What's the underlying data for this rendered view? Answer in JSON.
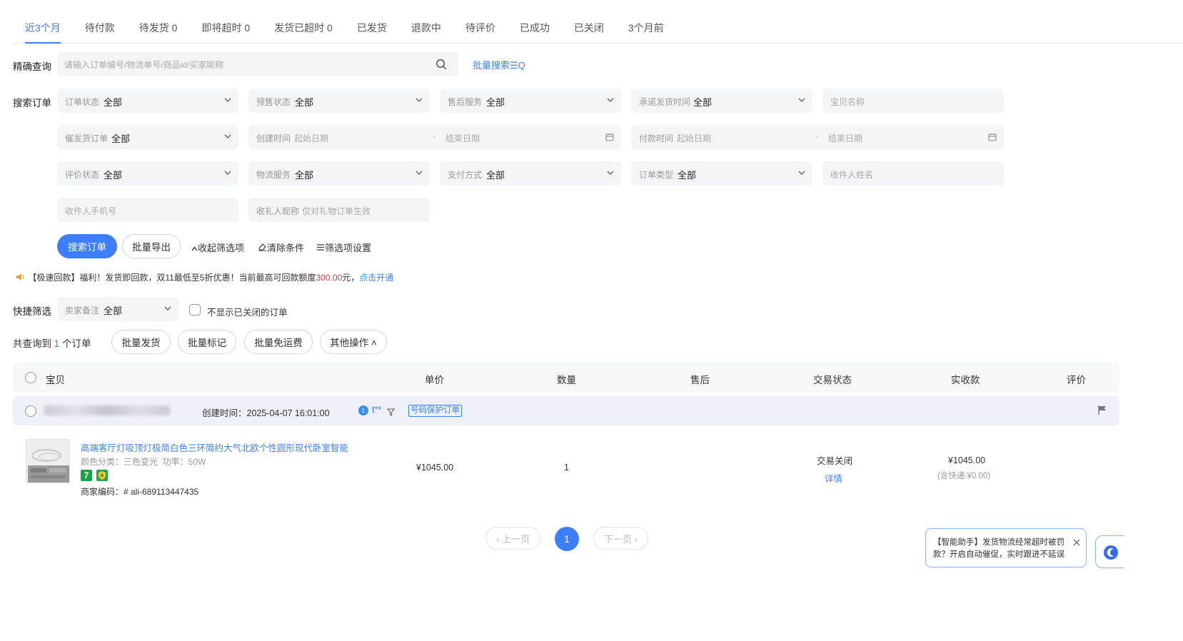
{
  "tabs": [
    "近3个月",
    "待付款",
    "待发货 0",
    "即将超时 0",
    "发货已超时 0",
    "已发货",
    "退款中",
    "待评价",
    "已成功",
    "已关闭",
    "3个月前"
  ],
  "precise": {
    "label": "精确查询",
    "placeholder": "请输入订单编号/物流单号/商品id/买家昵称",
    "batch_search": "批量搜索☰Q"
  },
  "filters": {
    "label": "搜索订单",
    "order_status": {
      "label": "订单状态",
      "value": "全部"
    },
    "presale_status": {
      "label": "预售状态",
      "value": "全部"
    },
    "after_sale": {
      "label": "售后服务",
      "value": "全部"
    },
    "promised_ship": {
      "label": "承诺发货时间",
      "value": "全部"
    },
    "item_name": {
      "placeholder": "宝贝名称"
    },
    "urge_ship": {
      "label": "催发货订单",
      "value": "全部"
    },
    "created_time": {
      "label": "创建时间",
      "start": "起始日期",
      "sep": "-",
      "end": "结束日期"
    },
    "paid_time": {
      "label": "付款时间",
      "start": "起始日期",
      "sep": "-",
      "end": "结束日期"
    },
    "review_status": {
      "label": "评价状态",
      "value": "全部"
    },
    "logistics": {
      "label": "物流服务",
      "value": "全部"
    },
    "payment": {
      "label": "支付方式",
      "value": "全部"
    },
    "order_type": {
      "label": "订单类型",
      "value": "全部"
    },
    "receiver_name": {
      "placeholder": "收件人姓名"
    },
    "receiver_phone": {
      "placeholder": "收件人手机号"
    },
    "gift_nick": {
      "label": "收礼人昵称",
      "hint": "仅对礼物订单生效"
    }
  },
  "actions": {
    "search": "搜索订单",
    "export": "批量导出",
    "collapse": "收起筛选项",
    "clear": "清除条件",
    "settings": "筛选项设置"
  },
  "notice": {
    "text1": "【极速回款】福利！发货即回款，双11最低至5折优惠！当前最高可回款额度",
    "amount": "300.00",
    "text2": "元，",
    "link": "点击开通"
  },
  "quick": {
    "label": "快捷筛选",
    "seller_note": {
      "label": "卖家备注",
      "value": "全部"
    },
    "hide_closed": "不显示已关闭的订单"
  },
  "summary": {
    "prefix": "共查询到",
    "count": "1",
    "suffix": "个订单"
  },
  "bulk": {
    "ship": "批量发货",
    "mark": "批量标记",
    "free_ship": "批量免运费",
    "other": "其他操作 ˄"
  },
  "table": {
    "headers": [
      "宝贝",
      "单价",
      "数量",
      "售后",
      "交易状态",
      "实收款",
      "评价"
    ]
  },
  "order": {
    "created": "创建时间：2025-04-07 16:01:00",
    "buyer": "t**",
    "badge": "号码保护订单",
    "product": {
      "title": "高端客厅灯吸顶灯极简白色三环简约大气北欧个性圆形现代卧室智能",
      "spec": "颜色分类：三色变光  功率：50W",
      "tag7": "7",
      "merchant_code": "商家编码：# ali-689113447435"
    },
    "price": "¥1045.00",
    "qty": "1",
    "status": "交易关闭",
    "detail": "详情",
    "received": "¥1045.00",
    "shipping": "(含快递:¥0.00)"
  },
  "pager": {
    "prev": "‹ 上一页",
    "page": "1",
    "next": "下一页 ›"
  },
  "assistant": {
    "text": "【智能助手】发货物流经常超时被罚款？开启自动催促，实时跟进不延误"
  },
  "colors": {
    "accent": "#3d7eff",
    "red": "#e4393c",
    "field_bg": "#f4f5f7"
  }
}
